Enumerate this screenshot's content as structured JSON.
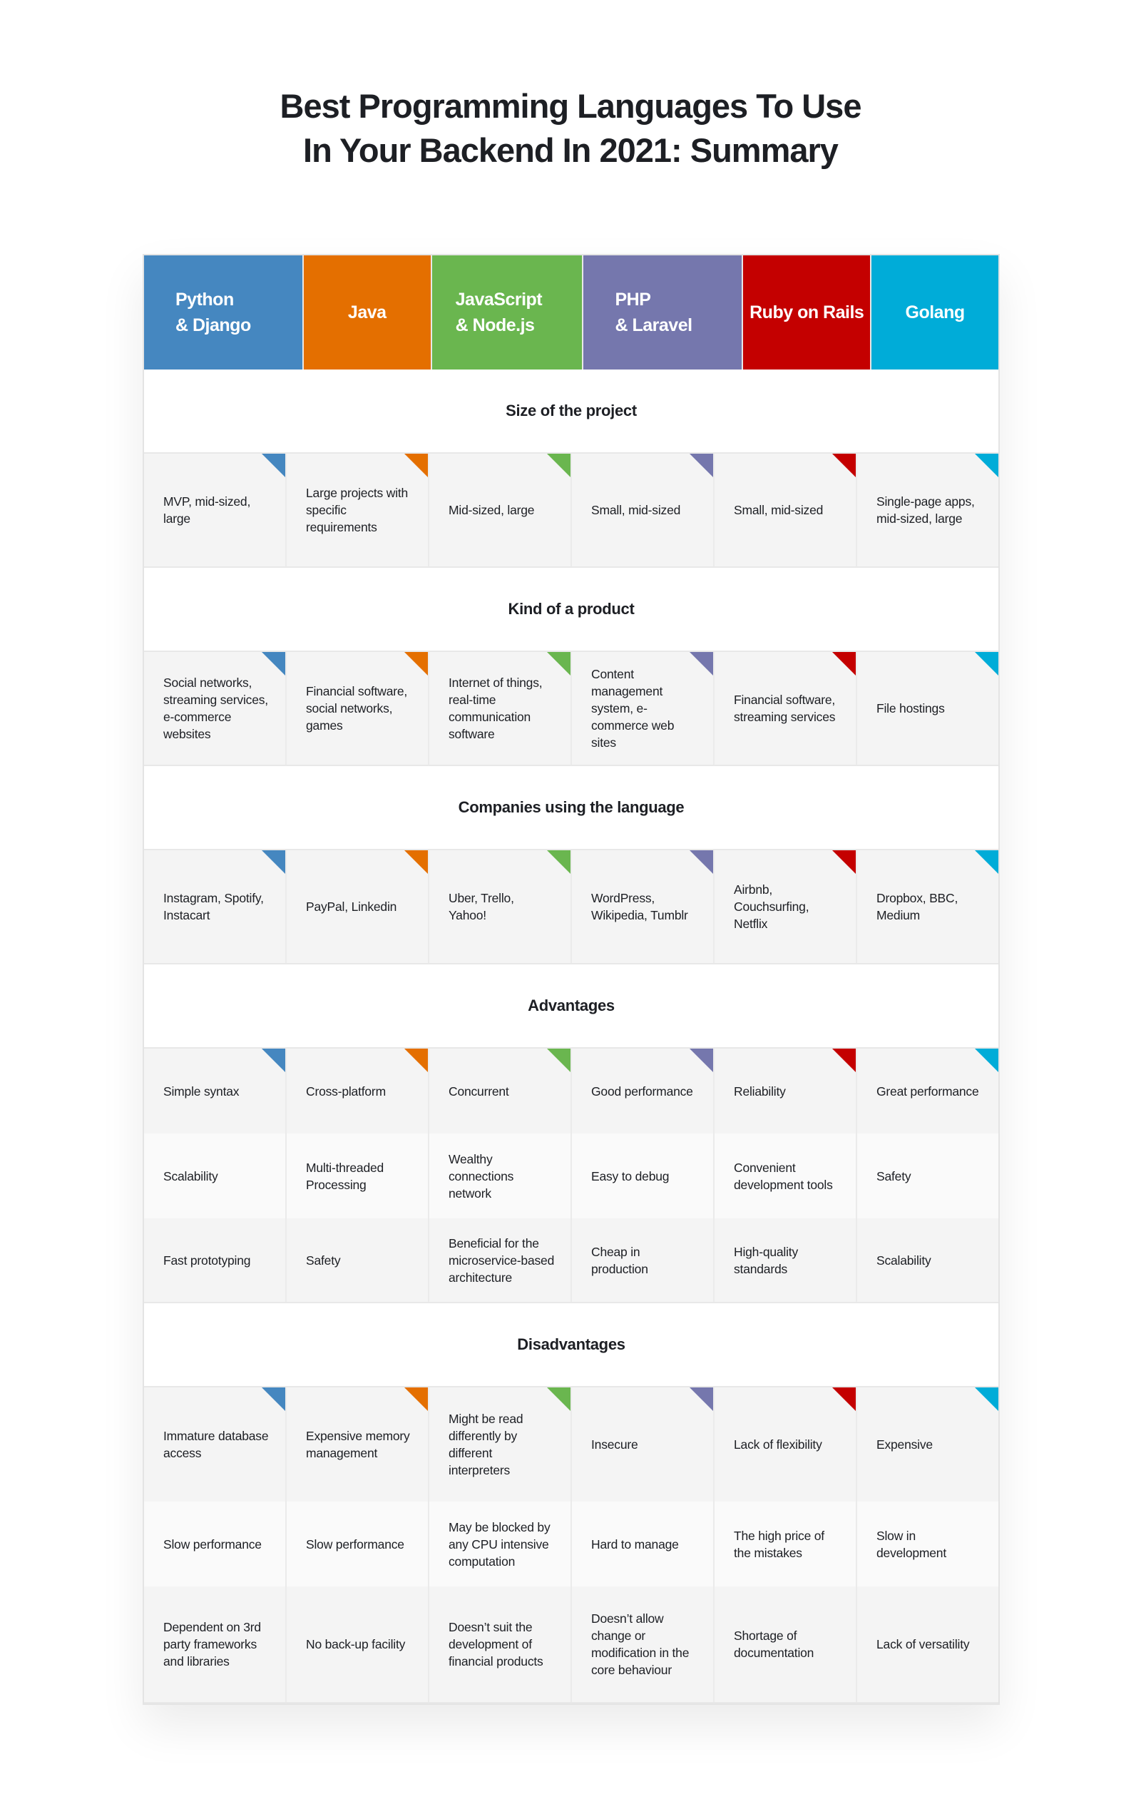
{
  "title": "Best Programming Languages To Use In Your Backend In 2021: Summary",
  "title_lines": [
    "Best Programming Languages To Use",
    "In Your Backend In 2021: Summary"
  ],
  "languages": [
    {
      "name": "Python & Django",
      "lines": [
        "Python",
        "& Django"
      ],
      "color": "#4587c0"
    },
    {
      "name": "Java",
      "lines": [
        "Java"
      ],
      "color": "#e46f00"
    },
    {
      "name": "JavaScript & Node.js",
      "lines": [
        "JavaScript",
        "& Node.js"
      ],
      "color": "#6ab64f"
    },
    {
      "name": "PHP & Laravel",
      "lines": [
        "PHP",
        "& Laravel"
      ],
      "color": "#7577ad"
    },
    {
      "name": "Ruby on Rails",
      "lines": [
        "Ruby on Rails"
      ],
      "color": "#c40000"
    },
    {
      "name": "Golang",
      "lines": [
        "Golang"
      ],
      "color": "#00acd8"
    }
  ],
  "sections": [
    {
      "title": "Size of the project",
      "rows": [
        [
          "MVP, mid-sized, large",
          "Large projects with specific requirements",
          "Mid-sized, large",
          "Small, mid-sized",
          "Small, mid-sized",
          "Single-page apps, mid-sized, large"
        ]
      ]
    },
    {
      "title": "Kind of a product",
      "rows": [
        [
          "Social networks, streaming services, e-commerce websites",
          "Financial software, social networks, games",
          "Internet of things, real-time communication software",
          "Content management system, e-commerce web sites",
          "Financial software, streaming services",
          "File hostings"
        ]
      ]
    },
    {
      "title": "Companies using the language",
      "rows": [
        [
          "Instagram, Spotify, Instacart",
          "PayPal, Linkedin",
          "Uber, Trello, Yahoo!",
          "WordPress, Wikipedia, Tumblr",
          "Airbnb, Couchsurfing, Netflix",
          "Dropbox, BBC, Medium"
        ]
      ]
    },
    {
      "title": "Advantages",
      "rows": [
        [
          "Simple syntax",
          "Cross-platform",
          "Concurrent",
          "Good performance",
          "Reliability",
          "Great performance"
        ],
        [
          "Scalability",
          "Multi-threaded Processing",
          "Wealthy connections network",
          "Easy to debug",
          "Convenient development tools",
          "Safety"
        ],
        [
          "Fast prototyping",
          "Safety",
          "Beneficial for the microservice-based architecture",
          "Cheap in production",
          "High-quality standards",
          "Scalability"
        ]
      ]
    },
    {
      "title": "Disadvantages",
      "rows": [
        [
          "Immature database access",
          "Expensive memory management",
          "Might be read differently by different interpreters",
          "Insecure",
          "Lack of flexibility",
          "Expensive"
        ],
        [
          "Slow performance",
          "Slow performance",
          "May be blocked by any CPU intensive computation",
          "Hard to manage",
          "The high price of the mistakes",
          "Slow in development"
        ],
        [
          "Dependent on 3rd party frameworks and libraries",
          "No back-up facility",
          "Doesn’t suit the development of financial products",
          "Doesn’t allow change or modification in the core behaviour",
          "Shortage of documentation",
          "Lack of versatility"
        ]
      ]
    }
  ]
}
